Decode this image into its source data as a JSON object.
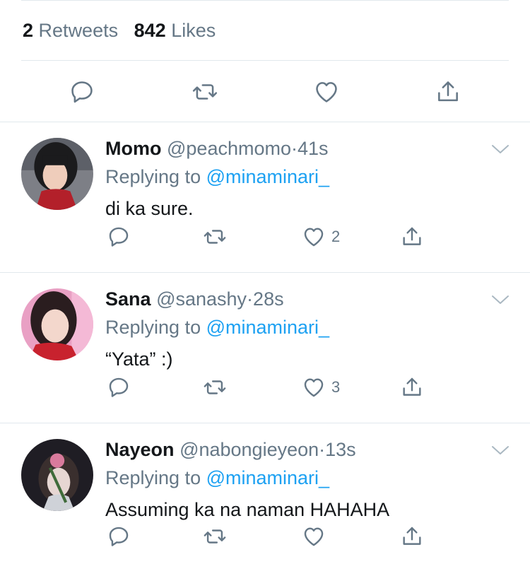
{
  "stats": {
    "retweets_count": "2",
    "retweets_label": "Retweets",
    "likes_count": "842",
    "likes_label": "Likes"
  },
  "actions": [
    "reply-icon",
    "retweet-icon",
    "like-icon",
    "share-icon"
  ],
  "colors": {
    "text": "#14171a",
    "secondary": "#657786",
    "mention": "#1da1f2",
    "divider": "#e1e8ed",
    "chevron": "#aab8c2"
  },
  "replies": [
    {
      "name": "Momo",
      "handle": "@peachmomo",
      "dot": "·",
      "time": "41s",
      "replying_to_label": "Replying to",
      "mention": "@minaminari_",
      "text": "di ka sure.",
      "likes": "2"
    },
    {
      "name": "Sana",
      "handle": "@sanashy",
      "dot": "·",
      "time": "28s",
      "replying_to_label": "Replying to",
      "mention": "@minaminari_",
      "text": "“Yata” :)",
      "likes": "3"
    },
    {
      "name": "Nayeon",
      "handle": "@nabongieyeon",
      "dot": "·",
      "time": "13s",
      "replying_to_label": "Replying to",
      "mention": "@minaminari_",
      "text": "Assuming ka na naman HAHAHA",
      "likes": ""
    }
  ]
}
